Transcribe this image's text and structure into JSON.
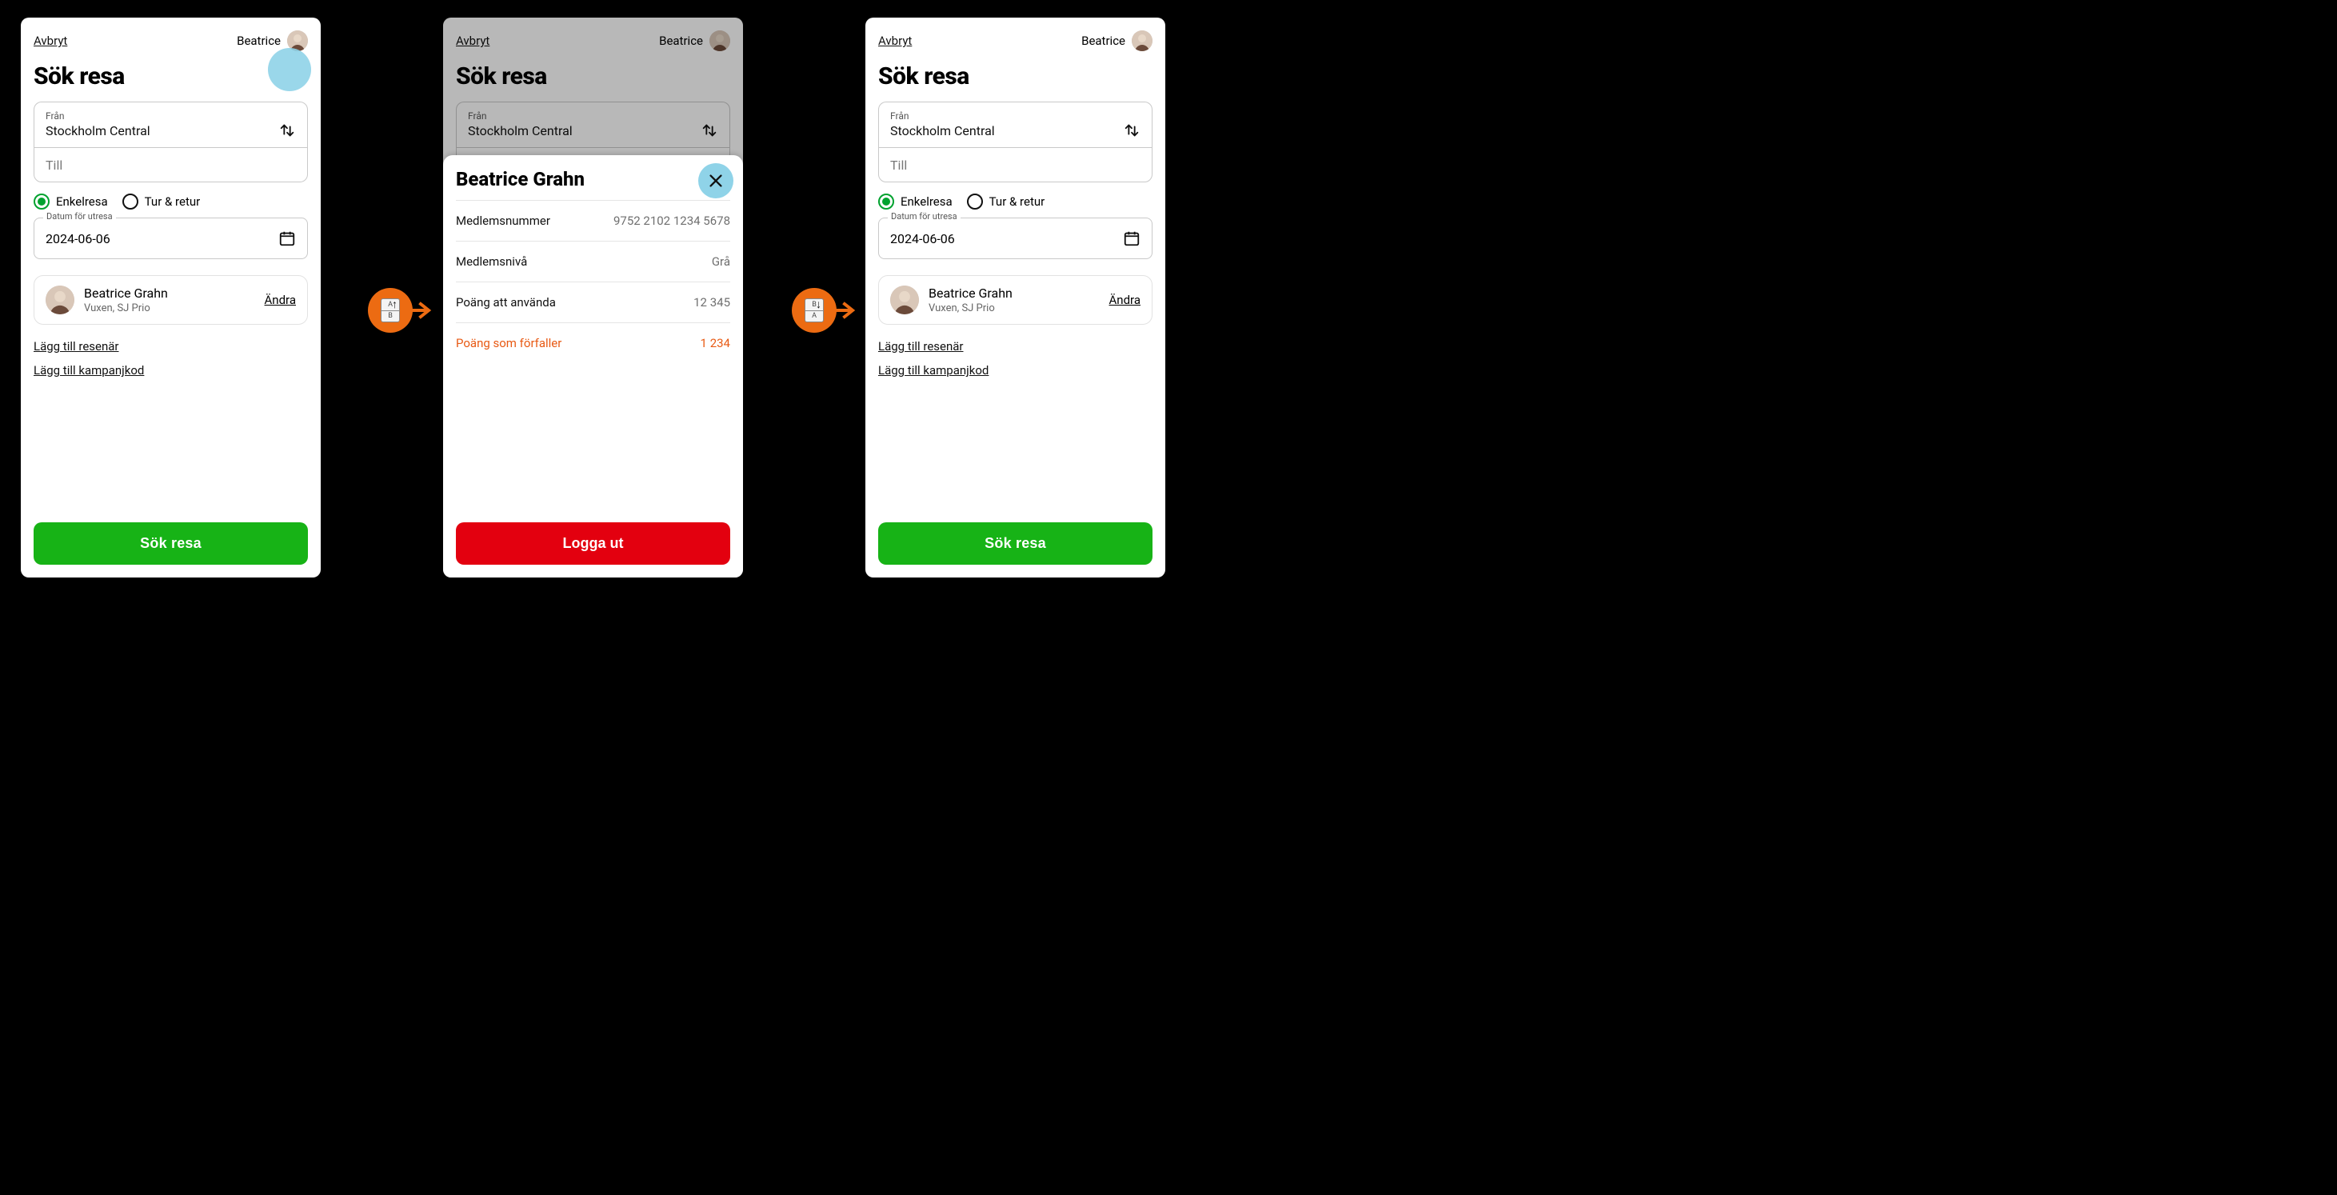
{
  "common": {
    "cancel": "Avbryt",
    "user_name": "Beatrice",
    "title": "Sök resa",
    "from_label": "Från",
    "from_value": "Stockholm Central",
    "to_label": "Till",
    "to_value": "",
    "trip_single": "Enkelresa",
    "trip_return": "Tur & retur",
    "date_label": "Datum för utresa",
    "date_value": "2024-06-06",
    "traveler_name": "Beatrice Grahn",
    "traveler_sub": "Vuxen, SJ Prio",
    "change": "Ändra",
    "add_traveler": "Lägg till resenär",
    "add_promo": "Lägg till kampanjkod",
    "cta": "Sök resa"
  },
  "sheet": {
    "title": "Beatrice Grahn",
    "rows": [
      {
        "k": "Medlemsnummer",
        "v": "9752 2102 1234 5678"
      },
      {
        "k": "Medlemsnivå",
        "v": "Grå"
      },
      {
        "k": "Poäng att använda",
        "v": "12 345"
      },
      {
        "k": "Poäng som förfaller",
        "v": "1 234",
        "expiring": true
      }
    ],
    "logout": "Logga ut"
  },
  "transitions": {
    "t1": {
      "topLetter": "A",
      "bottomLetter": "B",
      "dir": "up"
    },
    "t2": {
      "topLetter": "B",
      "bottomLetter": "A",
      "dir": "down"
    }
  }
}
